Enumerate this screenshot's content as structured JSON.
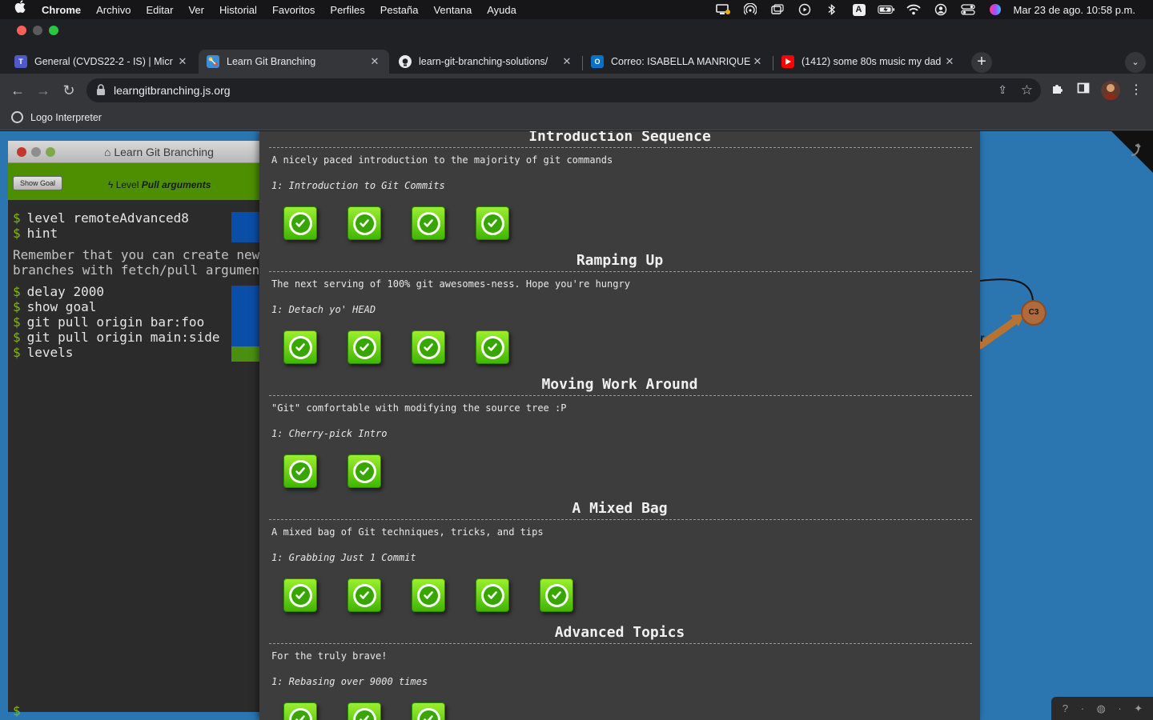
{
  "menubar": {
    "items": [
      "Chrome",
      "Archivo",
      "Editar",
      "Ver",
      "Historial",
      "Favoritos",
      "Perfiles",
      "Pestaña",
      "Ventana",
      "Ayuda"
    ],
    "clock": "Mar 23 de ago.  10:58 p.m.",
    "input_source": "A"
  },
  "tabs": [
    {
      "title": "General (CVDS22-2 - IS) | Micr",
      "favicon": "teams-icon",
      "color": "#5059c9",
      "active": false
    },
    {
      "title": "Learn Git Branching",
      "favicon": "learn-git-branching-icon",
      "color": "#3a8fd6",
      "active": true
    },
    {
      "title": "learn-git-branching-solutions/",
      "favicon": "github-icon",
      "color": "#e8eaed",
      "active": false
    },
    {
      "title": "Correo: ISABELLA MANRIQUE",
      "favicon": "outlook-icon",
      "color": "#0a72c6",
      "active": false
    },
    {
      "title": "(1412) some 80s music my dad",
      "favicon": "youtube-icon",
      "color": "#ff0000",
      "active": false
    }
  ],
  "address_bar": {
    "url": "learngitbranching.js.org"
  },
  "bookmarks": [
    {
      "label": "Logo Interpreter"
    }
  ],
  "terminal": {
    "title": "Learn Git Branching",
    "show_goal_label": "Show Goal",
    "level_prefix": "Level",
    "level_name": "Pull arguments",
    "prompt_symbol": "$",
    "commands_before_hint": [
      "level remoteAdvanced8",
      "hint"
    ],
    "hint_lines": [
      "Remember that you can create new",
      "branches with fetch/pull argumen"
    ],
    "commands_after_hint": [
      "delay 2000",
      "show goal",
      "git pull origin bar:foo",
      "git pull origin main:side",
      "levels"
    ]
  },
  "sequences": [
    {
      "title": "Introduction Sequence",
      "about": "A nicely paced introduction to the majority of git commands",
      "first_level": "1: Introduction to Git Commits",
      "levels_completed": 4
    },
    {
      "title": "Ramping Up",
      "about": "The next serving of 100% git awesomes-ness. Hope you're hungry",
      "first_level": "1: Detach yo' HEAD",
      "levels_completed": 4
    },
    {
      "title": "Moving Work Around",
      "about": "\"Git\" comfortable with modifying the source tree :P",
      "first_level": "1: Cherry-pick Intro",
      "levels_completed": 2
    },
    {
      "title": "A Mixed Bag",
      "about": "A mixed bag of Git techniques, tricks, and tips",
      "first_level": "1: Grabbing Just 1 Commit",
      "levels_completed": 5
    },
    {
      "title": "Advanced Topics",
      "about": "For the truly brave!",
      "first_level": "1: Rebasing over 9000 times",
      "levels_completed": 3
    }
  ],
  "graph": {
    "commit_label": "C3",
    "branch_fragment": "r"
  },
  "colors": {
    "level_complete": "#3fb700",
    "background": "#2b75b0",
    "prompt": "#81b90f",
    "goal_bar": "#4d8f00"
  }
}
